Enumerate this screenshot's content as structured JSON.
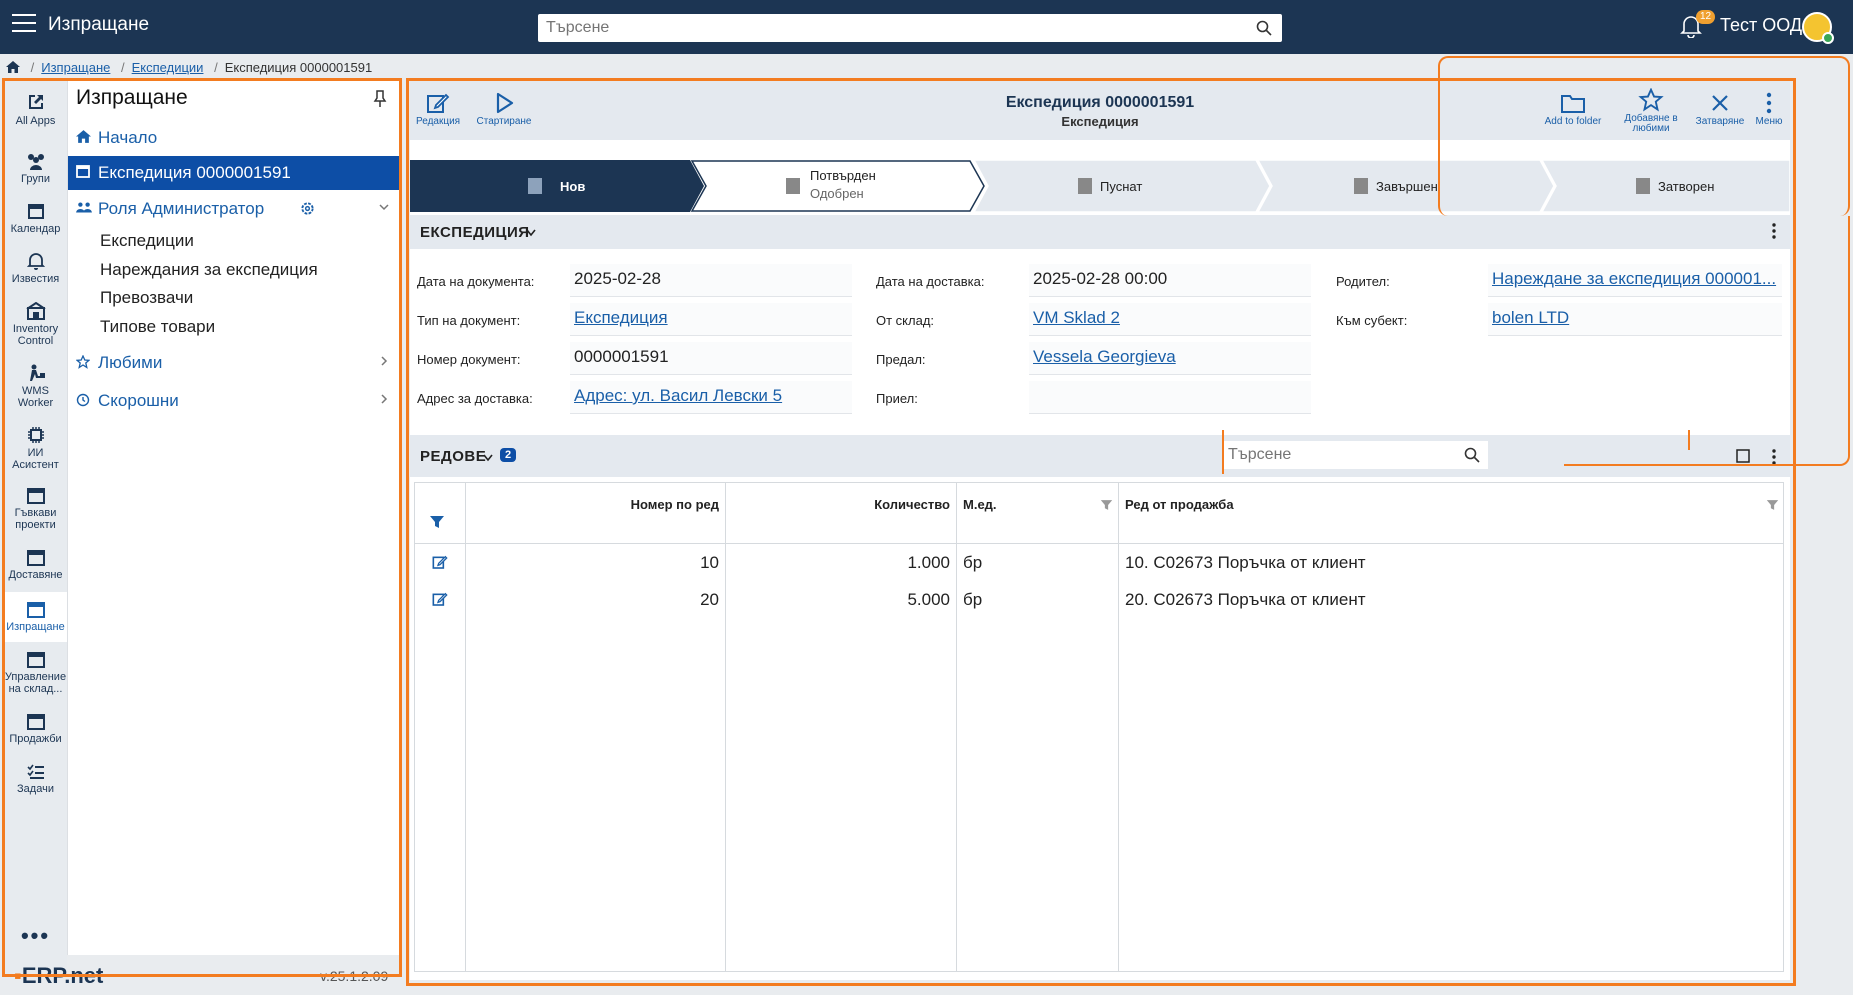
{
  "topbar": {
    "app_title": "Изпращане",
    "search_placeholder": "Търсене",
    "notifications_count": "12",
    "company": "Тест ООД"
  },
  "breadcrumb": {
    "items": [
      "Изпращане",
      "Експедиции"
    ],
    "current": "Експедиция 0000001591"
  },
  "rail": [
    {
      "label": "All Apps",
      "icon": "all-apps-icon"
    },
    {
      "label": "Групи",
      "icon": "groups-icon"
    },
    {
      "label": "Календар",
      "icon": "calendar-icon"
    },
    {
      "label": "Известия",
      "icon": "bell-icon"
    },
    {
      "label": "Inventory Control",
      "icon": "inventory-icon"
    },
    {
      "label": "WMS Worker",
      "icon": "worker-icon"
    },
    {
      "label": "ИИ Асистент",
      "icon": "ai-chip-icon"
    },
    {
      "label": "Гъвкави проекти",
      "icon": "window-icon"
    },
    {
      "label": "Доставяне",
      "icon": "window-icon"
    },
    {
      "label": "Изпращане",
      "icon": "window-icon"
    },
    {
      "label": "Управление на склад...",
      "icon": "window-icon"
    },
    {
      "label": "Продажби",
      "icon": "window-icon"
    },
    {
      "label": "Задачи",
      "icon": "tasks-icon"
    }
  ],
  "nav": {
    "title": "Изпращане",
    "home": "Начало",
    "selected": "Експедиция 0000001591",
    "role": "Роля Администратор",
    "sub_items": [
      "Експедиции",
      "Нареждания за експедиция",
      "Превозвачи",
      "Типове товари"
    ],
    "favorites": "Любими",
    "recent": "Скорошни"
  },
  "footer": {
    "brand": "ERP.net",
    "version": "v.25.1.2.09"
  },
  "toolbar": {
    "edit": "Редакция",
    "start": "Стартиране",
    "title": "Експедиция 0000001591",
    "subtitle": "Експедиция",
    "add_to_folder": "Add to folder",
    "favorite": "Добавяне в любими",
    "close": "Затваряне",
    "menu": "Меню"
  },
  "stepper": [
    {
      "label": "Нов",
      "sub": "",
      "state": "active"
    },
    {
      "label": "Потвърден",
      "sub": "Одобрен",
      "state": "next"
    },
    {
      "label": "Пуснат",
      "sub": "",
      "state": "future"
    },
    {
      "label": "Завършен",
      "sub": "",
      "state": "future"
    },
    {
      "label": "Затворен",
      "sub": "",
      "state": "future"
    }
  ],
  "section_shipment": {
    "title": "ЕКСПЕДИЦИЯ",
    "fields": {
      "doc_date_label": "Дата на документа:",
      "doc_date": "2025-02-28",
      "doc_type_label": "Тип на документ:",
      "doc_type": "Експедиция",
      "doc_no_label": "Номер документ:",
      "doc_no": "0000001591",
      "address_label": "Адрес за доставка:",
      "address": "Адрес: ул. Васил Левски 5",
      "delivery_date_label": "Дата на доставка:",
      "delivery_date": "2025-02-28 00:00",
      "from_store_label": "От склад:",
      "from_store": "VM Sklad 2",
      "handed_label": "Предал:",
      "handed": "Vessela Georgieva",
      "received_label": "Приел:",
      "received": "",
      "parent_label": "Родител:",
      "parent": "Нареждане за експедиция 000001...",
      "subject_label": "Към субект:",
      "subject": "bolen LTD"
    }
  },
  "section_lines": {
    "title": "РЕДОВЕ",
    "count": "2",
    "search_placeholder": "Търсене",
    "columns": [
      "Номер по ред",
      "Количество",
      "М.ед.",
      "Ред от продажба"
    ],
    "rows": [
      {
        "no": "10",
        "qty": "1.000",
        "unit": "бр",
        "sales_line": "10. C02673 Поръчка от клиент"
      },
      {
        "no": "20",
        "qty": "5.000",
        "unit": "бр",
        "sales_line": "20. C02673 Поръчка от клиент"
      }
    ]
  },
  "colors": {
    "topbar": "#1c3553",
    "accent": "#1a5fa8",
    "highlight": "#f37c20",
    "selected": "#0d4ea6"
  }
}
